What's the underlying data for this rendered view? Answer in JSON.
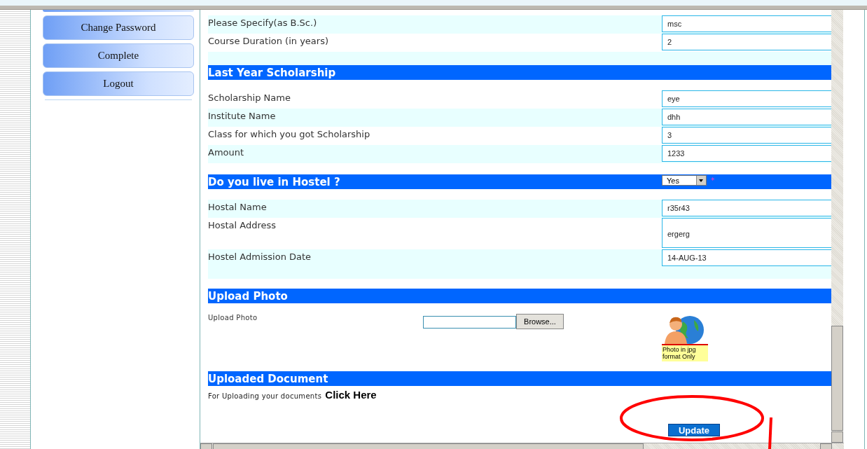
{
  "sidebar": {
    "items": [
      {
        "label": "Change Password"
      },
      {
        "label": "Complete"
      },
      {
        "label": "Logout"
      }
    ]
  },
  "form": [
    {
      "kind": "fields",
      "rows": [
        {
          "label": "Please Specify(as B.Sc.)",
          "value": "msc",
          "shaded": true,
          "kind": "text"
        },
        {
          "label": "Course Duration (in years)",
          "value": "2",
          "shaded": false,
          "kind": "text"
        }
      ]
    },
    {
      "kind": "header",
      "title": "Last Year Scholarship"
    },
    {
      "kind": "fields",
      "rows": [
        {
          "label": "Scholarship Name",
          "value": "eye",
          "shaded": false,
          "kind": "text"
        },
        {
          "label": "Institute Name",
          "value": "dhh",
          "shaded": true,
          "kind": "text"
        },
        {
          "label": "Class for which you got Scholarship",
          "value": "3",
          "shaded": false,
          "kind": "text"
        },
        {
          "label": "Amount",
          "value": "1233",
          "shaded": true,
          "kind": "text"
        }
      ]
    },
    {
      "kind": "header",
      "title": "Do you live in Hostel ?",
      "select": {
        "value": "Yes"
      },
      "required_mark": "*"
    },
    {
      "kind": "fields",
      "rows": [
        {
          "label": "Hostal Name",
          "value": "r35r43",
          "shaded": true,
          "kind": "text"
        },
        {
          "label": "Hostal Address",
          "value": "ergerg",
          "shaded": false,
          "kind": "textarea"
        },
        {
          "label": "Hostel Admission Date",
          "value": "14-AUG-13",
          "shaded": true,
          "kind": "text"
        }
      ]
    },
    {
      "kind": "header",
      "title": "Upload Photo"
    },
    {
      "kind": "upload",
      "label": "Upload Photo",
      "button": "Browse...",
      "note": "Photo in jpg format Only"
    },
    {
      "kind": "header",
      "title": "Uploaded Document"
    },
    {
      "kind": "link_line",
      "text": "For Uploading your documents",
      "link": "Click Here"
    },
    {
      "kind": "submit",
      "button": "Update"
    }
  ]
}
